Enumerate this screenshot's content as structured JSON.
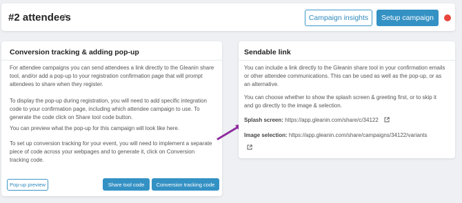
{
  "header": {
    "title": "#2 attendees",
    "campaign_insights_label": "Campaign insights",
    "setup_campaign_label": "Setup campaign",
    "status_color": "#e8453c"
  },
  "left_card": {
    "title": "Conversion tracking & adding pop-up",
    "paragraphs": [
      "For attendee campaigns you can send attendees a link directly to the Gleanin share tool, and/or add a pop-up to your registration confirmation page that will prompt attendees to share when they register.",
      "To display the pop-up during registration, you will need to add specific integration code to your confirmation page, including which attendee campaign to use. To generate the code click on Share tool code button.",
      "You can preview what the pop-up for this campaign will look like here.",
      "To set up conversion tracking for your event, you will need to implement a separate piece of code across your webpages and to generate it, click on Conversion tracking code."
    ],
    "popup_preview_label": "Pop-up preview",
    "share_tool_code_label": "Share tool code",
    "conversion_tracking_code_label": "Conversion tracking code"
  },
  "right_card": {
    "title": "Sendable link",
    "paragraphs": [
      "You can include a link directly to the Gleanin share tool in your confirmation emails or other attendee communications. This can be used as well as the pop-up, or as an alternative.",
      "You can choose whether to show the splash screen & greeting first, or to skip it and go directly to the image & selection."
    ],
    "splash_label": "Splash screen:",
    "splash_url": "https://app.gleanin.com/share/c/34122",
    "image_label": "Image selection:",
    "image_url": "https://app.gleanin.com/share/campaigns/34122/variants"
  },
  "colors": {
    "accent": "#3491c4",
    "arrow": "#8e2a9e",
    "background": "#eef0f3"
  },
  "icons": [
    "pencil-icon",
    "external-link-icon",
    "arrow-annotation"
  ]
}
